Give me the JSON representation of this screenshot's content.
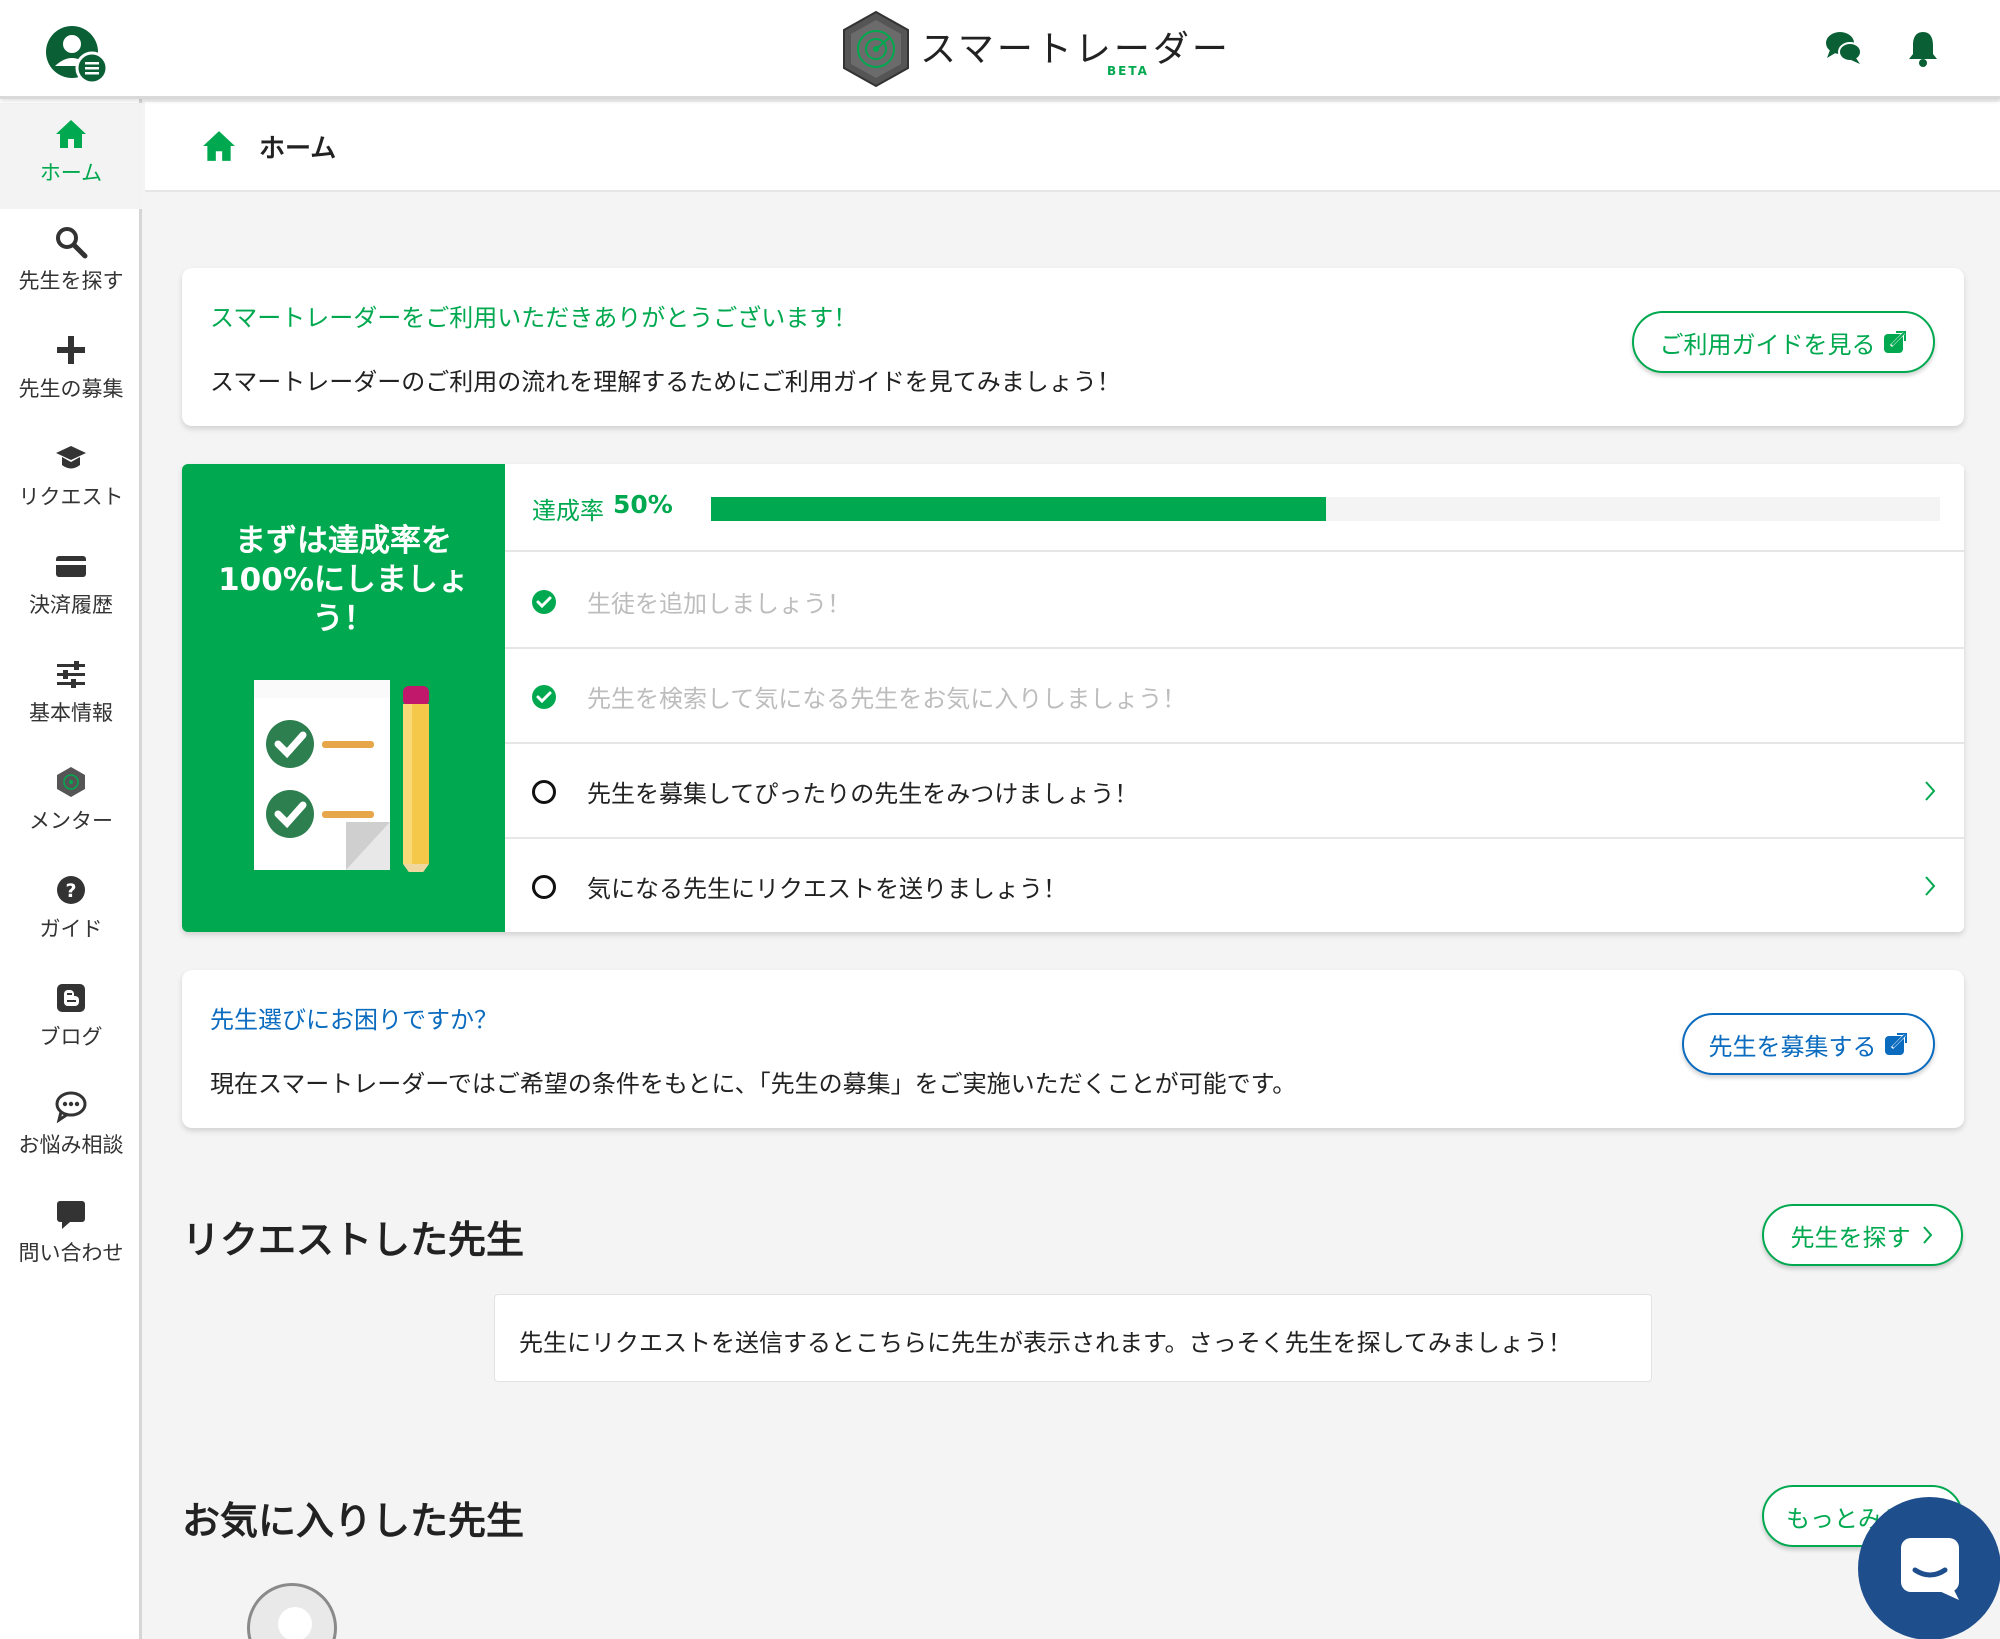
{
  "app": {
    "logo_text": "スマートレーダー",
    "logo_badge": "BETA"
  },
  "colors": {
    "brand_green": "#00a94f",
    "link_blue": "#0a6bbf",
    "text": "#222222",
    "muted": "#bdbdbd"
  },
  "topbar": {
    "icons": [
      "account-menu-icon",
      "chat-icon",
      "bell-icon"
    ]
  },
  "sidebar": {
    "items": [
      {
        "label": "ホーム",
        "icon": "home-icon",
        "active": true
      },
      {
        "label": "先生を探す",
        "icon": "search-icon"
      },
      {
        "label": "先生の募集",
        "icon": "plus-icon"
      },
      {
        "label": "リクエスト",
        "icon": "graduation-cap-icon"
      },
      {
        "label": "決済履歴",
        "icon": "credit-card-icon"
      },
      {
        "label": "基本情報",
        "icon": "sliders-icon"
      },
      {
        "label": "メンター",
        "icon": "mentor-logo-icon"
      },
      {
        "label": "ガイド",
        "icon": "question-icon"
      },
      {
        "label": "ブログ",
        "icon": "blog-icon"
      },
      {
        "label": "お悩み相談",
        "icon": "comment-dots-icon"
      },
      {
        "label": "問い合わせ",
        "icon": "message-icon"
      }
    ]
  },
  "header": {
    "title": "ホーム"
  },
  "welcome_card": {
    "title": "スマートレーダーをご利用いただきありがとうございます！",
    "text": "スマートレーダーのご利用の流れを理解するためにご利用ガイドを見てみましょう！",
    "button": "ご利用ガイドを見る"
  },
  "progress": {
    "left_title": "まずは達成率を100%にしましょう！",
    "rate_label": "達成率",
    "rate_text": "50%",
    "rate_value": 0.5,
    "tasks": [
      {
        "text": "生徒を追加しましょう！",
        "done": true
      },
      {
        "text": "先生を検索して気になる先生をお気に入りしましょう！",
        "done": true
      },
      {
        "text": "先生を募集してぴったりの先生をみつけましょう！",
        "done": false
      },
      {
        "text": "気になる先生にリクエストを送りましょう！",
        "done": false
      }
    ]
  },
  "recruit_card": {
    "title": "先生選びにお困りですか？",
    "text": "現在スマートレーダーではご希望の条件をもとに、「先生の募集」をご実施いただくことが可能です。",
    "button": "先生を募集する"
  },
  "requested_section": {
    "title": "リクエストした先生",
    "button": "先生を探す",
    "empty_text": "先生にリクエストを送信するとこちらに先生が表示されます。さっそく先生を探してみましょう！"
  },
  "favorites_section": {
    "title": "お気に入りした先生",
    "button": "もっとみる"
  }
}
